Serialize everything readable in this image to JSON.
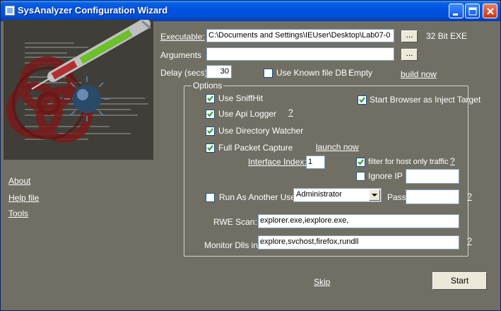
{
  "window": {
    "title": "SysAnalyzer Configuration Wizard"
  },
  "sidebar": {
    "about": "About",
    "help_file": "Help file",
    "tools": "Tools"
  },
  "executable": {
    "label": "Executable:",
    "value": "C:\\Documents and Settings\\IEUser\\Desktop\\Lab07-0",
    "browse": "...",
    "arch": "32 Bit EXE"
  },
  "arguments": {
    "label": "Arguments",
    "value": "",
    "browse": "..."
  },
  "delay": {
    "label": "Delay (secs)",
    "value": "30"
  },
  "known_file_db": {
    "label": "Use Known file DB :",
    "status": "Empty",
    "build_now": "build now"
  },
  "options": {
    "title": "Options",
    "use_sniffhit": "Use SniffHit",
    "start_browser": "Start Browser as Inject Target",
    "use_api_logger": "Use Api Logger",
    "use_directory_watcher": "Use Directory Watcher",
    "full_packet_capture": "Full Packet Capture",
    "launch_now": "launch now",
    "interface_index_label": "Interface Index:",
    "interface_index_value": "1",
    "filter_host_traffic": "filter for host only traffic",
    "ignore_ip": "Ignore IP",
    "ignore_ip_value": "",
    "run_as_user": "Run As Another User",
    "user_selected": "Administrator",
    "pass_label": "Pass",
    "pass_value": "",
    "rwe_scan_label": "RWE Scan:",
    "rwe_scan_value": "explorer.exe,iexplore.exe,",
    "monitor_dlls_label": "Monitor Dlls in:",
    "monitor_dlls_value": "explore,svchost,firefox,rundll",
    "help_q": "?"
  },
  "footer": {
    "skip": "Skip",
    "start": "Start"
  }
}
